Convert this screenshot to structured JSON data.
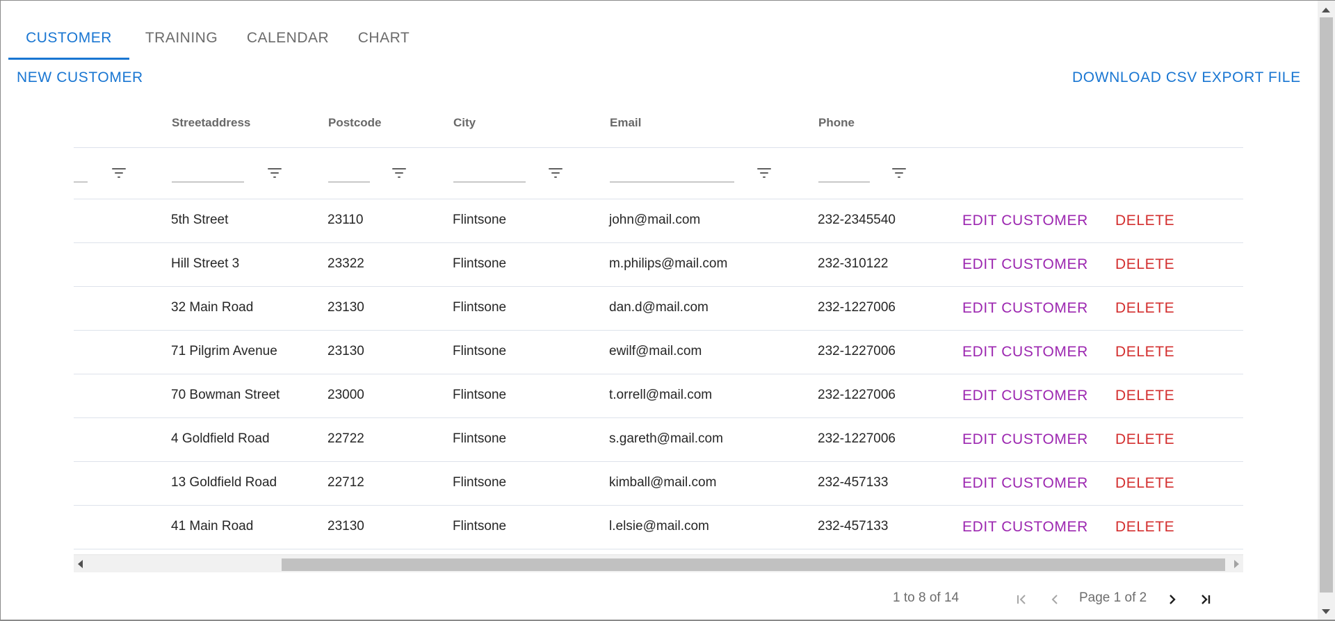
{
  "tabs": [
    {
      "label": "CUSTOMER",
      "active": true
    },
    {
      "label": "TRAINING",
      "active": false
    },
    {
      "label": "CALENDAR",
      "active": false
    },
    {
      "label": "CHART",
      "active": false
    }
  ],
  "toolbar": {
    "new_customer_label": "NEW CUSTOMER",
    "download_csv_label": "DOWNLOAD CSV EXPORT FILE"
  },
  "grid": {
    "columns": [
      "Streetaddress",
      "Postcode",
      "City",
      "Email",
      "Phone"
    ],
    "rows": [
      {
        "street": "5th Street",
        "postcode": "23110",
        "city": "Flintsone",
        "email": "john@mail.com",
        "phone": "232-2345540"
      },
      {
        "street": "Hill Street 3",
        "postcode": "23322",
        "city": "Flintsone",
        "email": "m.philips@mail.com",
        "phone": "232-310122"
      },
      {
        "street": "32 Main Road",
        "postcode": "23130",
        "city": "Flintsone",
        "email": "dan.d@mail.com",
        "phone": "232-1227006"
      },
      {
        "street": "71 Pilgrim Avenue",
        "postcode": "23130",
        "city": "Flintsone",
        "email": "ewilf@mail.com",
        "phone": "232-1227006"
      },
      {
        "street": "70 Bowman Street",
        "postcode": "23000",
        "city": "Flintsone",
        "email": "t.orrell@mail.com",
        "phone": "232-1227006"
      },
      {
        "street": "4 Goldfield Road",
        "postcode": "22722",
        "city": "Flintsone",
        "email": "s.gareth@mail.com",
        "phone": "232-1227006"
      },
      {
        "street": "13 Goldfield Road",
        "postcode": "22712",
        "city": "Flintsone",
        "email": "kimball@mail.com",
        "phone": "232-457133"
      },
      {
        "street": "41 Main Road",
        "postcode": "23130",
        "city": "Flintsone",
        "email": "l.elsie@mail.com",
        "phone": "232-457133"
      }
    ],
    "actions": {
      "edit_label": "EDIT CUSTOMER",
      "delete_label": "DELETE"
    }
  },
  "pagination": {
    "summary": "1 to 8 of 14",
    "page_label": "Page 1 of 2"
  },
  "icons": {
    "filter": "filter-icon",
    "first_page": "first-page-icon",
    "prev_page": "previous-page-icon",
    "next_page": "next-page-icon",
    "last_page": "last-page-icon"
  },
  "colors": {
    "primary": "#1976d2",
    "edit": "#9c27b0",
    "delete": "#d32f2f"
  }
}
